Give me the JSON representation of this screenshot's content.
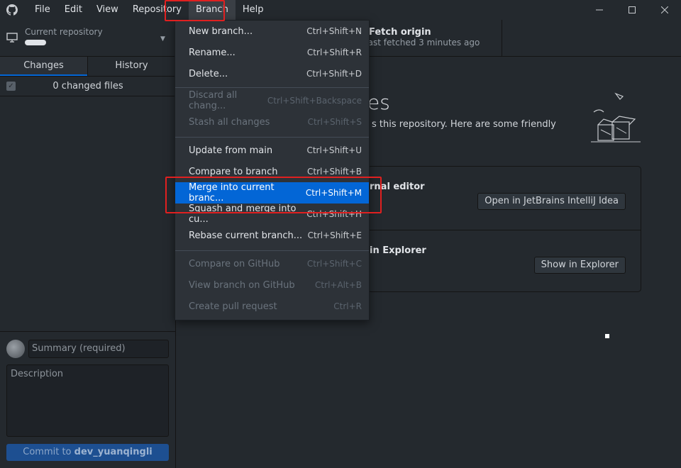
{
  "menu": {
    "items": [
      "File",
      "Edit",
      "View",
      "Repository",
      "Branch",
      "Help"
    ]
  },
  "repo": {
    "label": "Current repository"
  },
  "tabs": {
    "changes": "Changes",
    "history": "History"
  },
  "changes": {
    "count_text": "0 changed files"
  },
  "commit": {
    "summary_placeholder": "Summary (required)",
    "description_placeholder": "Description",
    "button_prefix": "Commit to ",
    "branch": "dev_yuanqingli"
  },
  "fetch": {
    "title": "Fetch origin",
    "subtitle": "Last fetched 3 minutes ago"
  },
  "main": {
    "title_fragment": "es",
    "subtitle_fragment": "s this repository. Here are some friendly",
    "card1_title_fragment": "rnal editor",
    "card1_button": "Open in JetBrains IntelliJ Idea",
    "card2_title_fragment": "in Explorer",
    "card2_button": "Show in Explorer"
  },
  "dropdown": {
    "items": [
      {
        "label": "New branch...",
        "accel": "Ctrl+Shift+N",
        "disabled": false
      },
      {
        "label": "Rename...",
        "accel": "Ctrl+Shift+R",
        "disabled": false
      },
      {
        "label": "Delete...",
        "accel": "Ctrl+Shift+D",
        "disabled": false
      },
      {
        "label": "Discard all chang...",
        "accel": "Ctrl+Shift+Backspace",
        "disabled": true
      },
      {
        "label": "Stash all changes",
        "accel": "Ctrl+Shift+S",
        "disabled": true
      },
      {
        "label": "Update from main",
        "accel": "Ctrl+Shift+U",
        "disabled": false
      },
      {
        "label": "Compare to branch",
        "accel": "Ctrl+Shift+B",
        "disabled": false
      },
      {
        "label": "Merge into current branc...",
        "accel": "Ctrl+Shift+M",
        "disabled": false,
        "highlighted": true
      },
      {
        "label": "Squash and merge into cu...",
        "accel": "Ctrl+Shift+H",
        "disabled": false
      },
      {
        "label": "Rebase current branch...",
        "accel": "Ctrl+Shift+E",
        "disabled": false
      },
      {
        "label": "Compare on GitHub",
        "accel": "Ctrl+Shift+C",
        "disabled": true
      },
      {
        "label": "View branch on GitHub",
        "accel": "Ctrl+Alt+B",
        "disabled": true
      },
      {
        "label": "Create pull request",
        "accel": "Ctrl+R",
        "disabled": true
      }
    ]
  },
  "colors": {
    "background": "#24292e",
    "accent": "#0366d6",
    "annotation": "#e02020"
  }
}
